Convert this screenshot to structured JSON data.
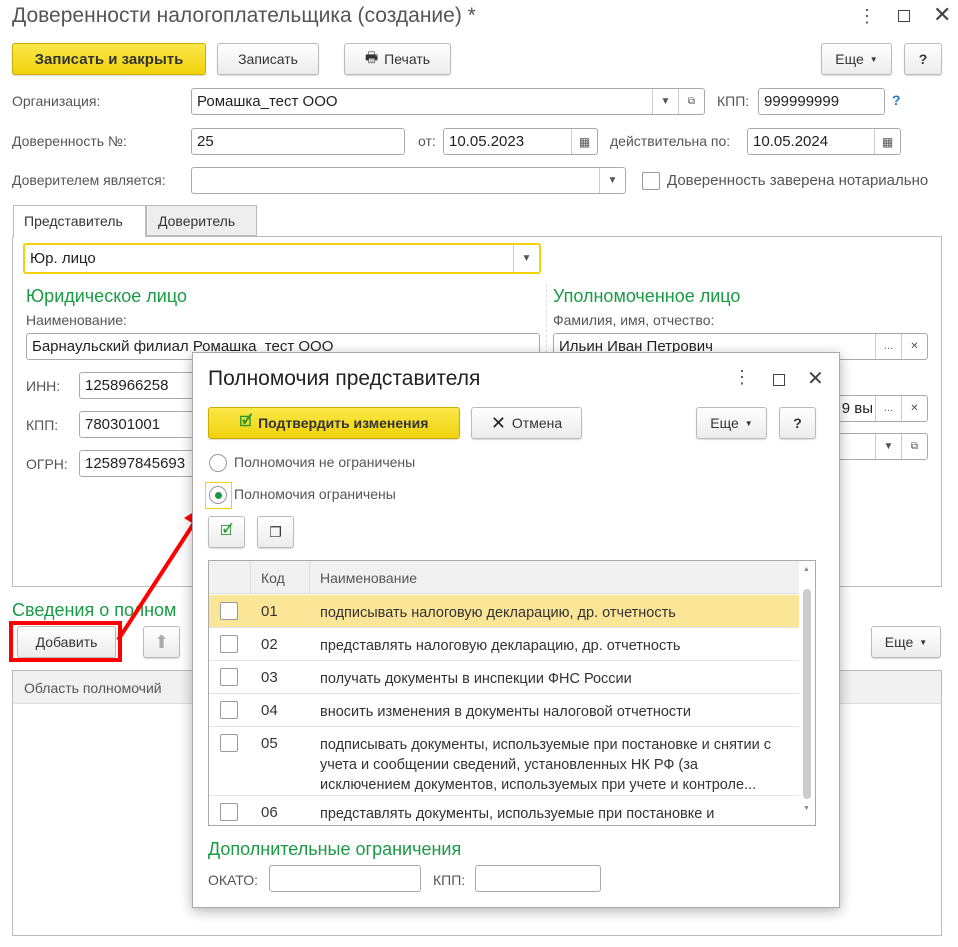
{
  "window": {
    "title": "Доверенности налогоплательщика (создание) *"
  },
  "toolbar": {
    "save_close": "Записать и закрыть",
    "save": "Записать",
    "print": "Печать",
    "more": "Еще",
    "help": "?"
  },
  "form": {
    "org_label": "Организация:",
    "org_value": "Ромашка_тест ООО",
    "kpp_label": "КПП:",
    "kpp_value": "999999999",
    "help": "?",
    "num_label": "Доверенность №:",
    "num_value": "25",
    "from_label": "от:",
    "from_value": "10.05.2023",
    "valid_label": "действительна по:",
    "valid_value": "10.05.2024",
    "principal_label": "Доверителем является:",
    "principal_value": "",
    "notary_label": "Доверенность заверена нотариально",
    "notary_checked": false
  },
  "tabs": [
    {
      "label": "Представитель",
      "active": true
    },
    {
      "label": "Доверитель",
      "active": false
    }
  ],
  "rep": {
    "type_value": "Юр. лицо",
    "legal_title": "Юридическое лицо",
    "name_label": "Наименование:",
    "name_value": "Барнаульский филиал Ромашка_тест ООО",
    "inn_label": "ИНН:",
    "inn_value": "1258966258",
    "kpp_label": "КПП:",
    "kpp_value": "780301001",
    "ogrn_label": "ОГРН:",
    "ogrn_value": "125897845693",
    "auth_title": "Уполномоченное лицо",
    "fio_label": "Фамилия, имя, отчество:",
    "fio_value": "Ильин Иван Петрович",
    "doc_value": "9 вы"
  },
  "powers": {
    "title": "Сведения о полном",
    "add": "Добавить",
    "more": "Еще",
    "column": "Область полномочий"
  },
  "dialog": {
    "title": "Полномочия представителя",
    "confirm": "Подтвердить изменения",
    "cancel": "Отмена",
    "more": "Еще",
    "help": "?",
    "radio_unlimited": "Полномочия не ограничены",
    "radio_limited": "Полномочия ограничены",
    "selected": "limited",
    "columns": [
      "Код",
      "Наименование"
    ],
    "rows": [
      {
        "code": "01",
        "name": "подписывать налоговую декларацию, др. отчетность",
        "checked": false
      },
      {
        "code": "02",
        "name": "представлять налоговую декларацию, др. отчетность",
        "checked": false
      },
      {
        "code": "03",
        "name": "получать документы в инспекции ФНС России",
        "checked": false
      },
      {
        "code": "04",
        "name": "вносить изменения в документы налоговой отчетности",
        "checked": false
      },
      {
        "code": "05",
        "name": "подписывать документы, используемые при постановке и снятии с учета и сообщении сведений, установленных НК РФ (за исключением документов, используемых при  учете и контроле...",
        "checked": false
      },
      {
        "code": "06",
        "name": "представлять документы, используемые при постановке и",
        "checked": false
      }
    ],
    "extra_title": "Дополнительные ограничения",
    "okato_label": "ОКАТО:",
    "okato_value": "",
    "kpp_label": "КПП:",
    "kpp_value": ""
  },
  "colors": {
    "accent": "#f1d20b",
    "green": "#1a9a44",
    "highlight": "#fbe697",
    "annotation": "#ff0000"
  }
}
